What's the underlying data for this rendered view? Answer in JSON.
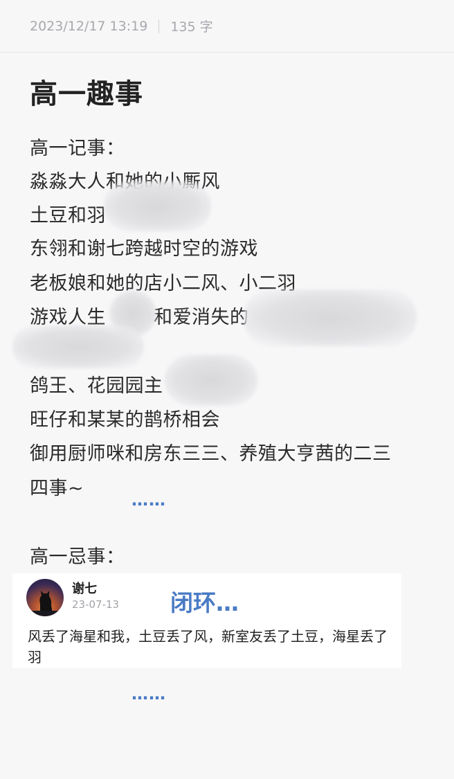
{
  "note": {
    "timestamp": "2023/12/17 13:19",
    "word_count": "135 字",
    "title": "高一趣事"
  },
  "body_lines": {
    "heading1": "高一记事：",
    "l1": "淼淼大人和她的小厮风",
    "l2": "土豆和羽",
    "l3": "东翎和谢七跨越时空的游戏",
    "l4": "老板娘和她的店小二风、小二羽",
    "l5a": "游戏人生",
    "l5b": "和爱消失的",
    "l7": "鸽王、花园园主",
    "l8": "旺仔和某某的鹊桥相会",
    "l9": "御用厨师咪和房东三三、养殖大亨茜的二三",
    "l10": "四事~",
    "dots1": "……",
    "heading2": "高一忌事：",
    "dots2": "……"
  },
  "comment": {
    "author": "谢七",
    "date": "23-07-13",
    "text": "风丢了海星和我，土豆丢了风，新室友丢了土豆，海星丢了羽"
  },
  "overlay": {
    "closed_loop": "闭环…"
  },
  "colors": {
    "accent": "#4a7bc4",
    "meta": "#a8a8ad",
    "background": "#f7f7f8"
  },
  "icons": {
    "avatar": "cat-silhouette-moon-avatar"
  }
}
